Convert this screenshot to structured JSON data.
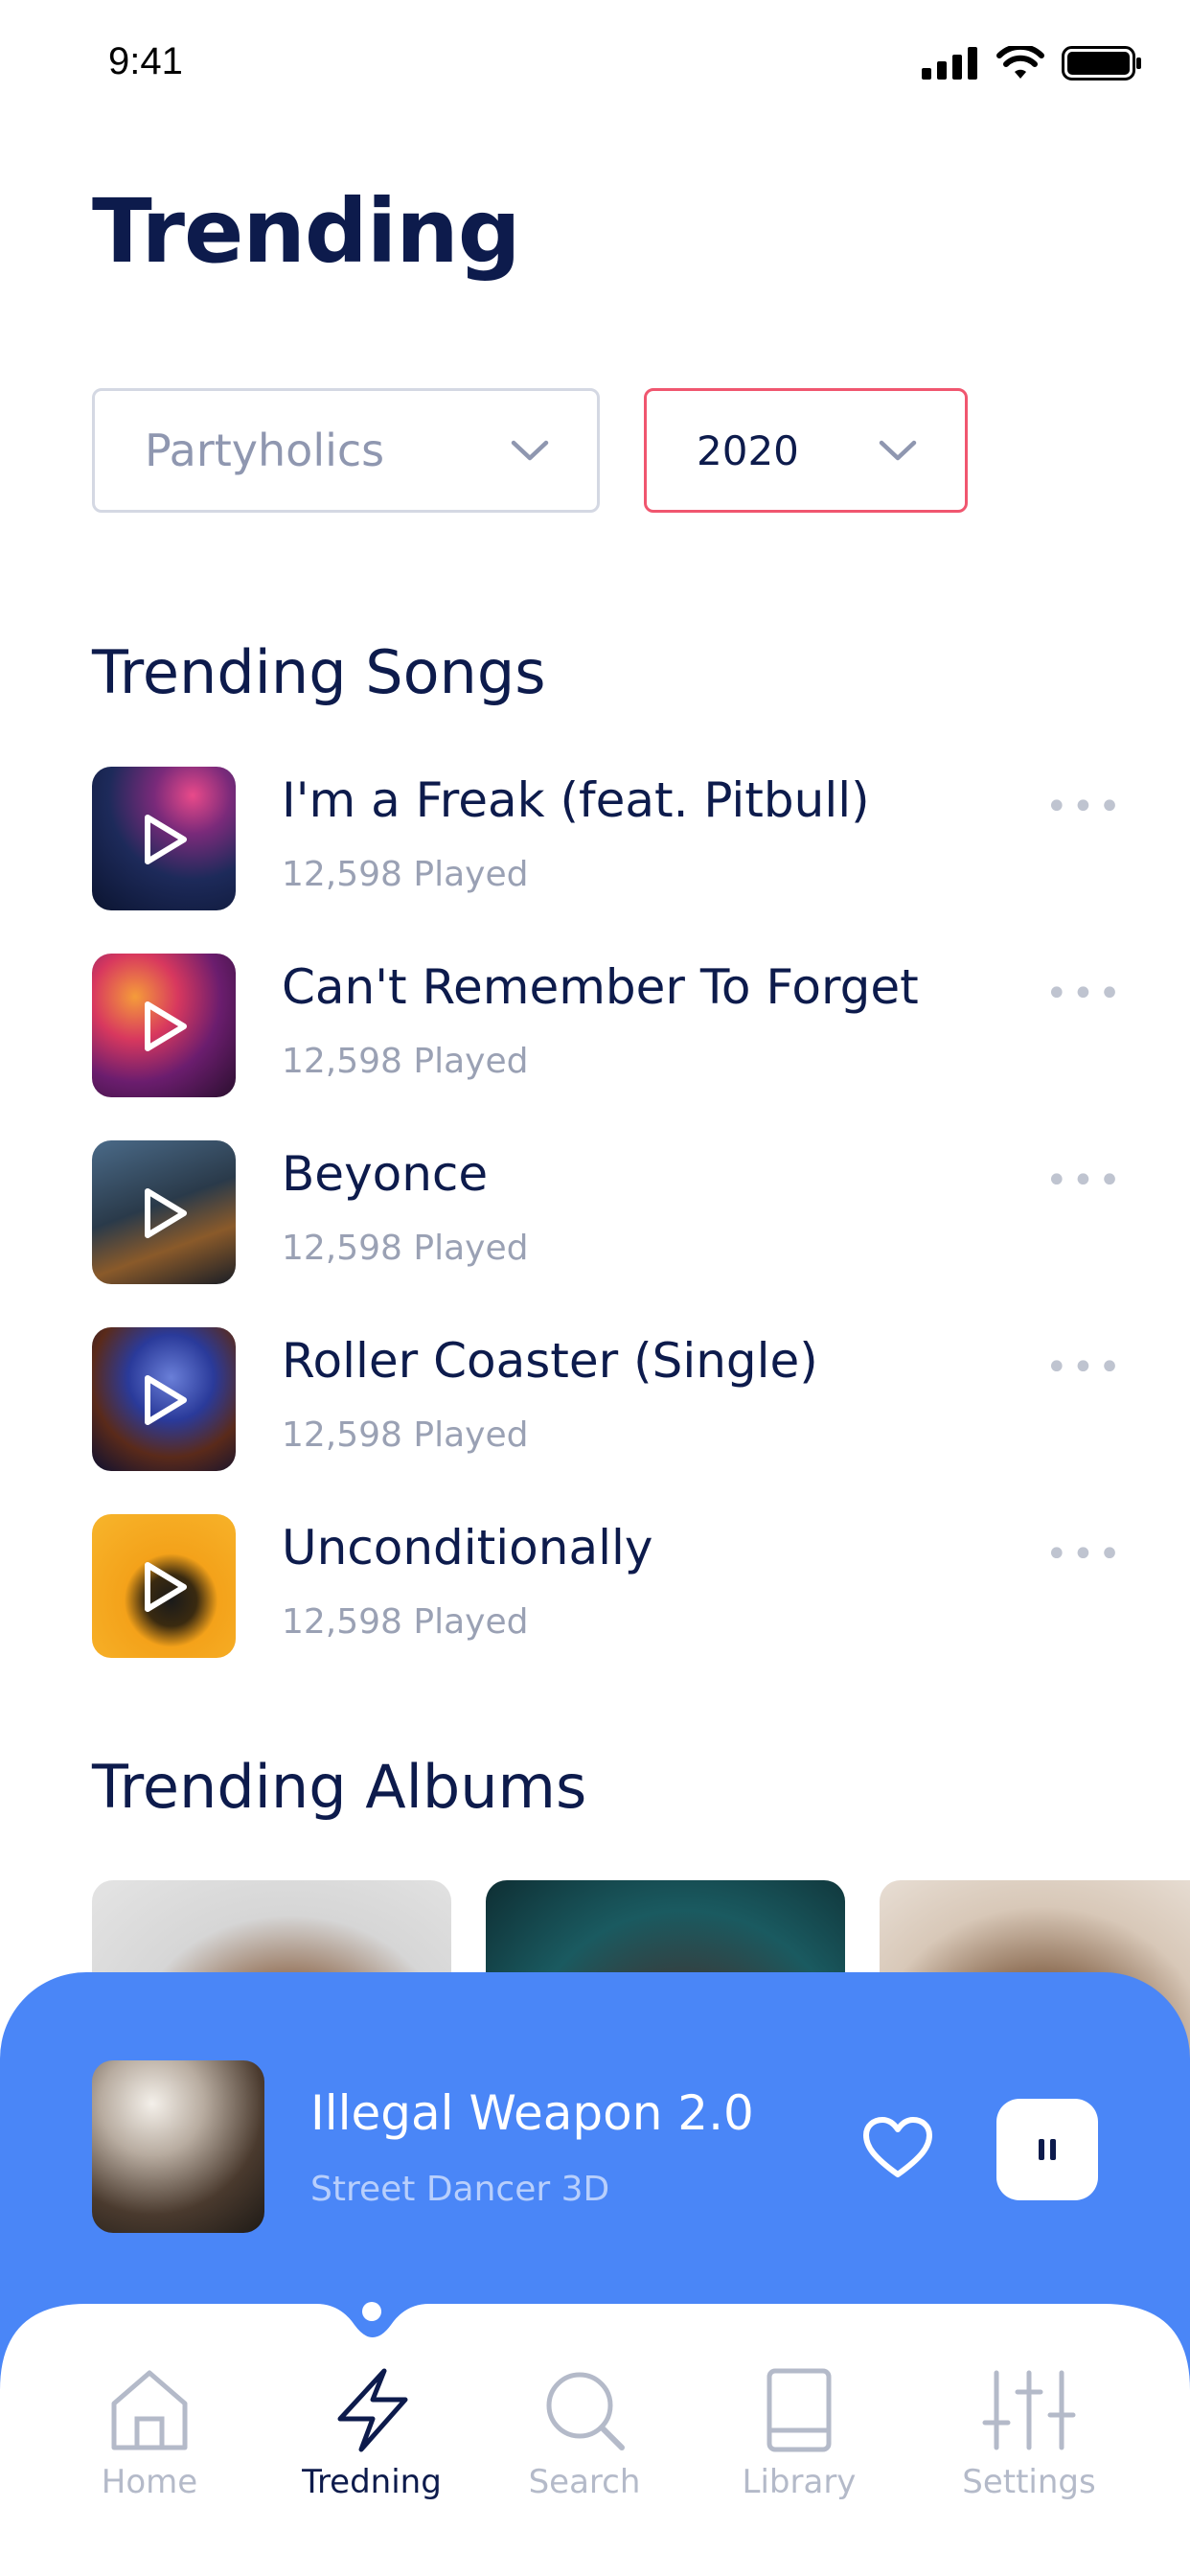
{
  "status_bar": {
    "time": "9:41"
  },
  "header": {
    "title": "Trending"
  },
  "filters": {
    "genre": {
      "selected": "Partyholics"
    },
    "year": {
      "selected": "2020"
    }
  },
  "songs_section": {
    "title": "Trending Songs",
    "items": [
      {
        "title": "I'm a Freak (feat. Pitbull)",
        "plays": "12,598 Played"
      },
      {
        "title": "Can't Remember To Forget",
        "plays": "12,598 Played"
      },
      {
        "title": "Beyonce",
        "plays": "12,598 Played"
      },
      {
        "title": "Roller Coaster (Single)",
        "plays": "12,598 Played"
      },
      {
        "title": "Unconditionally",
        "plays": "12,598 Played"
      }
    ],
    "more_label": "•••"
  },
  "albums_section": {
    "title": "Trending Albums"
  },
  "now_playing": {
    "title": "Illegal Weapon 2.0",
    "artist": "Street Dancer 3D"
  },
  "tab_bar": {
    "tabs": [
      {
        "label": "Home",
        "icon": "home-icon"
      },
      {
        "label": "Tredning",
        "icon": "lightning-icon"
      },
      {
        "label": "Search",
        "icon": "search-icon"
      },
      {
        "label": "Library",
        "icon": "book-icon"
      },
      {
        "label": "Settings",
        "icon": "sliders-icon"
      }
    ],
    "active_index": 1
  },
  "colors": {
    "primary_text": "#0d1b4c",
    "accent_blue": "#4a86f7",
    "accent_red": "#f0566f",
    "muted": "#9aa1b4"
  }
}
